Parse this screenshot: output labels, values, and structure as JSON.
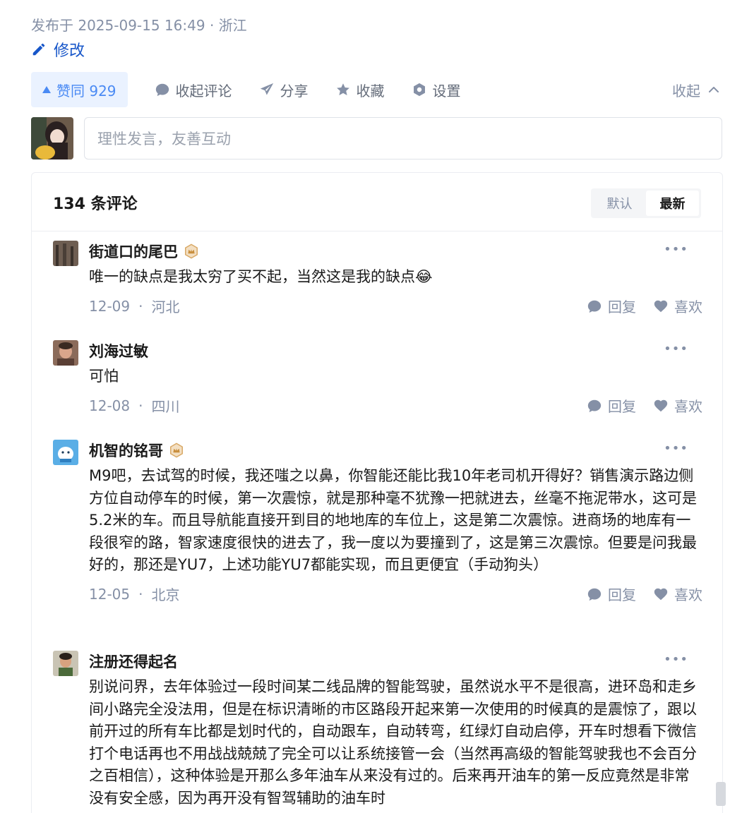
{
  "post": {
    "meta": "发布于 2025-09-15 16:49 · 浙江",
    "edit_label": "修改"
  },
  "actions": {
    "vote_label": "赞同 929",
    "collapse_comments": "收起评论",
    "share": "分享",
    "favorite": "收藏",
    "settings": "设置",
    "collapse": "收起"
  },
  "compose": {
    "placeholder": "理性发言，友善互动"
  },
  "comments": {
    "count_label": "134 条评论",
    "sort_default": "默认",
    "sort_latest": "最新",
    "reply_label": "回复",
    "like_label": "喜欢",
    "items": [
      {
        "name": "街道口的尾巴",
        "text": "唯一的缺点是我太穷了买不起，当然这是我的缺点😂",
        "date": "12-09",
        "location": "河北"
      },
      {
        "name": "刘海过敏",
        "text": "可怕",
        "date": "12-08",
        "location": "四川"
      },
      {
        "name": "机智的铭哥",
        "text": "M9吧，去试驾的时候，我还嗤之以鼻，你智能还能比我10年老司机开得好？销售演示路边侧方位自动停车的时候，第一次震惊，就是那种毫不犹豫一把就进去，丝毫不拖泥带水，这可是5.2米的车。而且导航能直接开到目的地地库的车位上，这是第二次震惊。进商场的地库有一段很窄的路，智家速度很快的进去了，我一度以为要撞到了，这是第三次震惊。但要是问我最好的，那还是YU7，上述功能YU7都能实现，而且更便宜（手动狗头）",
        "date": "12-05",
        "location": "北京"
      },
      {
        "name": "注册还得起名",
        "text": "别说问界，去年体验过一段时间某二线品牌的智能驾驶，虽然说水平不是很高，进环岛和走乡间小路完全没法用，但是在标识清晰的市区路段开起来第一次使用的时候真的是震惊了，跟以前开过的所有车比都是划时代的，自动跟车，自动转弯，红绿灯自动启停，开车时想看下微信打个电话再也不用战战兢兢了完全可以让系统接管一会（当然再高级的智能驾驶我也不会百分之百相信），这种体验是开那么多年油车从来没有过的。后来再开油车的第一反应竟然是非常没有安全感，因为再开没有智驾辅助的油车时"
      }
    ]
  }
}
